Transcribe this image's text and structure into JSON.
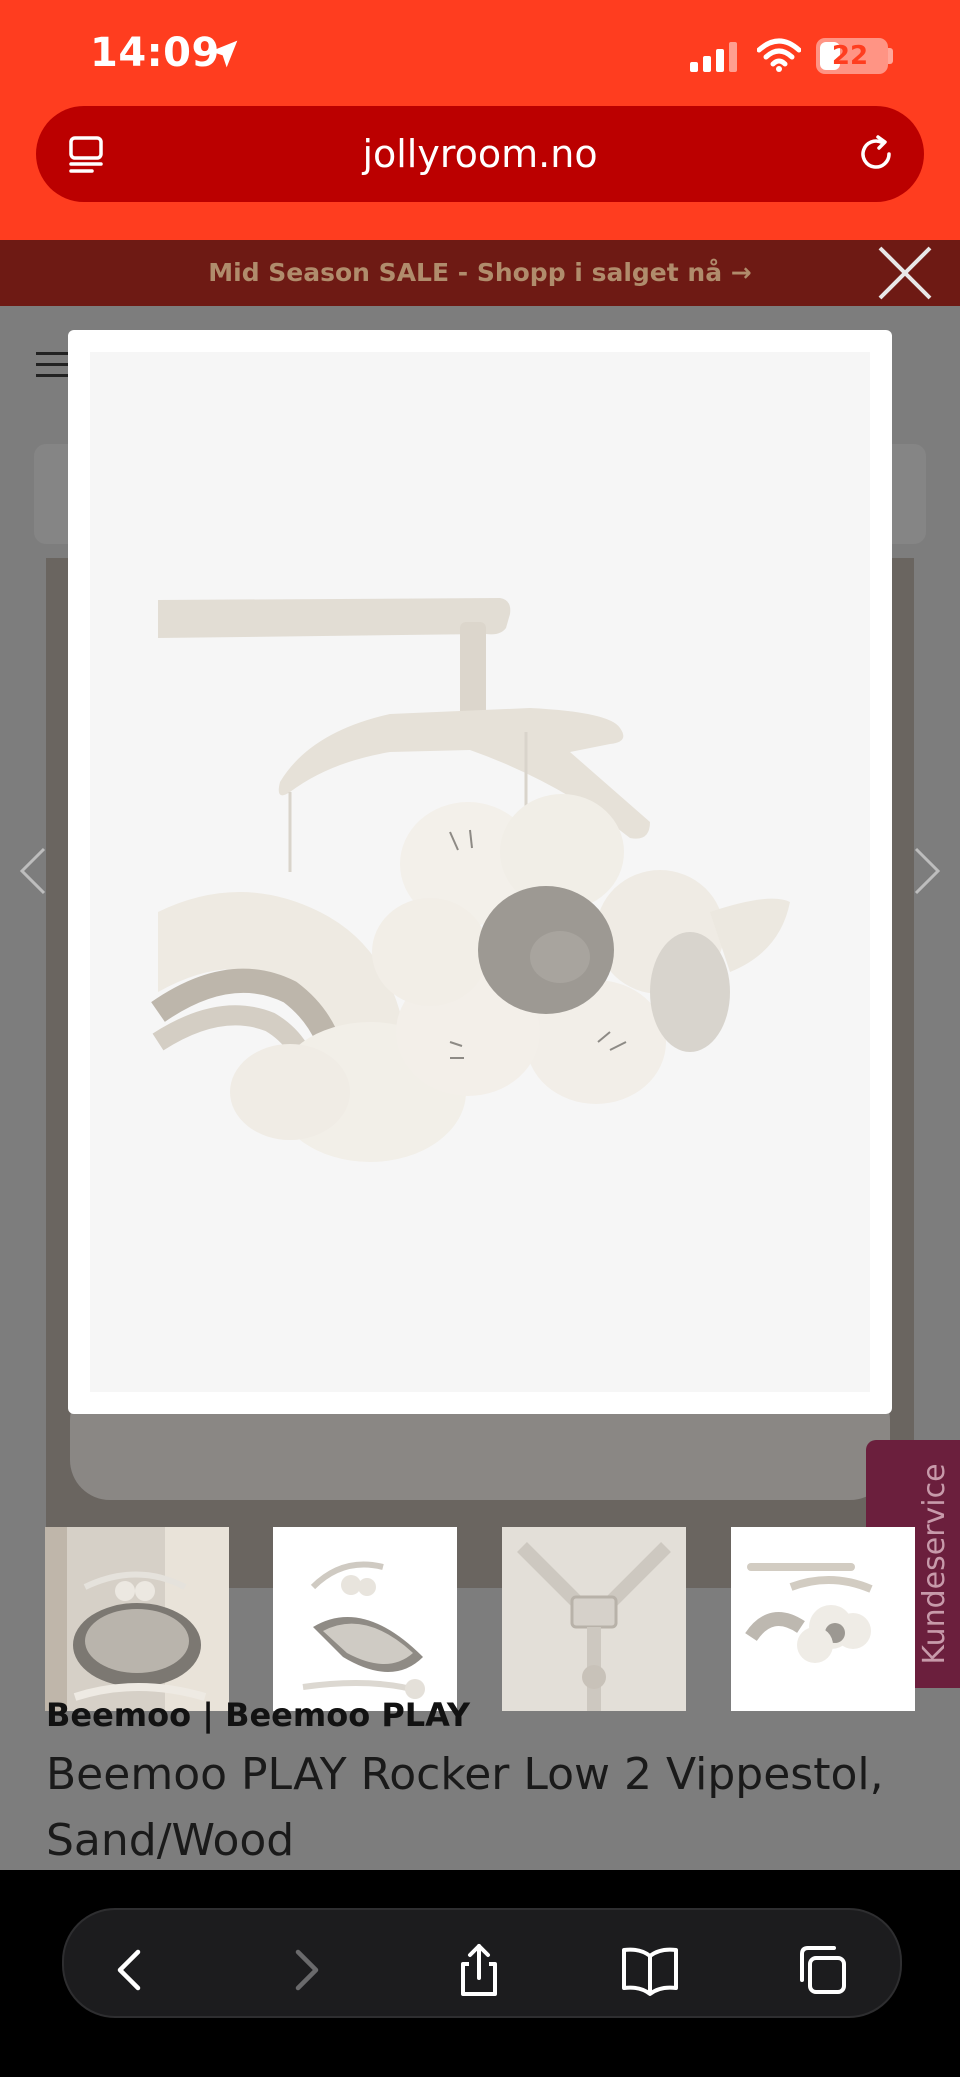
{
  "status_bar": {
    "time": "14:09",
    "battery": "22"
  },
  "browser": {
    "url": "jollyroom.no"
  },
  "promo_banner": {
    "text": "Mid Season SALE - Shopp i salget nå →"
  },
  "product": {
    "brand": "Beemoo | Beemoo PLAY",
    "title": "Beemoo PLAY Rocker Low 2 Vippestol, Sand/Wood"
  },
  "thumbnails": [
    {
      "name": "rocker-in-room"
    },
    {
      "name": "rocker-side-view"
    },
    {
      "name": "harness-detail"
    },
    {
      "name": "toy-bar-detail"
    }
  ],
  "kundeservice": {
    "label": "Kundeservice"
  },
  "toolbar": {
    "buttons": [
      "back",
      "forward",
      "share",
      "bookmarks",
      "tabs"
    ]
  },
  "colors": {
    "brand_red": "#ff3d1f",
    "url_bar": "#bb0000"
  }
}
